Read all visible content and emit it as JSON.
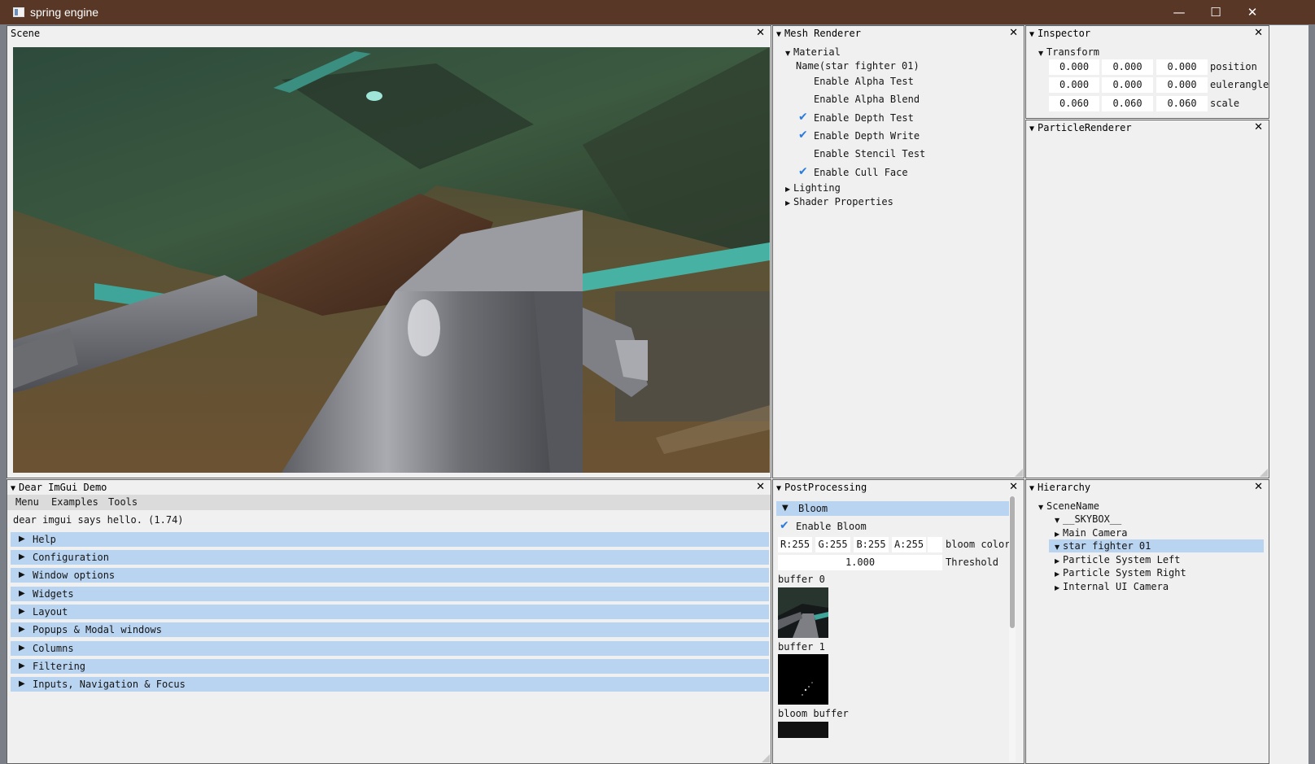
{
  "window": {
    "title": "spring engine",
    "minimize": "—",
    "maximize": "☐",
    "close": "✕"
  },
  "scene": {
    "title": "Scene"
  },
  "mesh_renderer": {
    "title": "Mesh Renderer",
    "material_header": "Material",
    "name": "Name(star fighter 01)",
    "options": [
      {
        "label": "Enable Alpha Test",
        "checked": false
      },
      {
        "label": "Enable Alpha Blend",
        "checked": false
      },
      {
        "label": "Enable Depth Test",
        "checked": true
      },
      {
        "label": "Enable Depth Write",
        "checked": true
      },
      {
        "label": "Enable Stencil Test",
        "checked": false
      },
      {
        "label": "Enable Cull Face",
        "checked": true
      }
    ],
    "sections": [
      "Lighting",
      "Shader Properties"
    ]
  },
  "inspector": {
    "title": "Inspector",
    "transform_header": "Transform",
    "rows": [
      {
        "label": "position",
        "values": [
          "0.000",
          "0.000",
          "0.000"
        ]
      },
      {
        "label": "eulerangle",
        "values": [
          "0.000",
          "0.000",
          "0.000"
        ]
      },
      {
        "label": "scale",
        "values": [
          "0.060",
          "0.060",
          "0.060"
        ]
      }
    ]
  },
  "particle_renderer": {
    "title": "ParticleRenderer"
  },
  "demo": {
    "title": "Dear ImGui Demo",
    "menu": [
      "Menu",
      "Examples",
      "Tools"
    ],
    "hello": "dear imgui says hello. (1.74)",
    "sections": [
      "Help",
      "Configuration",
      "Window options",
      "Widgets",
      "Layout",
      "Popups & Modal windows",
      "Columns",
      "Filtering",
      "Inputs, Navigation & Focus"
    ]
  },
  "post_processing": {
    "title": "PostProcessing",
    "bloom_header": "Bloom",
    "enable_bloom": "Enable Bloom",
    "color": {
      "r": "R:255",
      "g": "G:255",
      "b": "B:255",
      "a": "A:255",
      "label": "bloom color"
    },
    "threshold": {
      "value": "1.000",
      "label": "Threshold"
    },
    "buffers": [
      "buffer 0",
      "buffer 1",
      "bloom buffer"
    ]
  },
  "hierarchy": {
    "title": "Hierarchy",
    "root": "SceneName",
    "items": [
      {
        "label": "__SKYBOX__",
        "expanded": true,
        "selected": false
      },
      {
        "label": "Main Camera",
        "expanded": false,
        "selected": false
      },
      {
        "label": "star fighter 01",
        "expanded": true,
        "selected": true
      },
      {
        "label": "Particle System Left",
        "expanded": false,
        "selected": false
      },
      {
        "label": "Particle System Right",
        "expanded": false,
        "selected": false
      },
      {
        "label": "Internal UI Camera",
        "expanded": false,
        "selected": false
      }
    ]
  },
  "colors": {
    "titlebar": "#583726",
    "header": "#b9d4f1",
    "check": "#2a7bde",
    "panel": "#f0f0f0"
  },
  "icons": {
    "close": "close-icon",
    "collapse": "triangle-down-icon",
    "expand": "triangle-right-icon"
  }
}
